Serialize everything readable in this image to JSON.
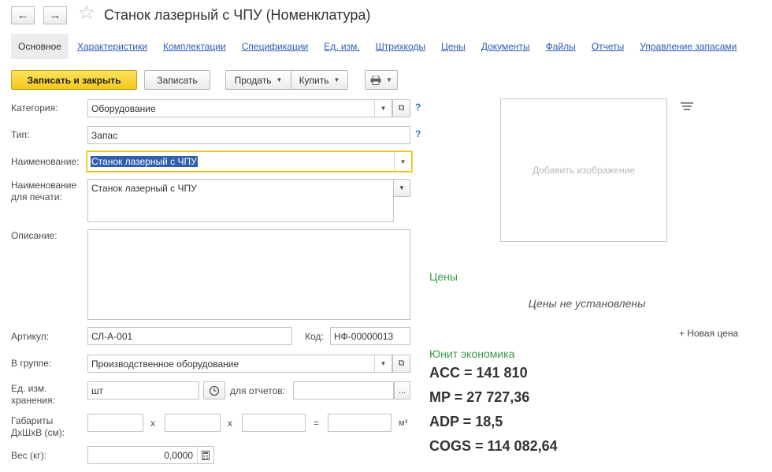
{
  "window": {
    "title": "Станок лазерный с ЧПУ (Номенклатура)",
    "back_icon": "←",
    "forward_icon": "→",
    "favorite_icon": "☆"
  },
  "tabs": [
    {
      "label": "Основное"
    },
    {
      "label": "Характеристики"
    },
    {
      "label": "Комплектации"
    },
    {
      "label": "Спецификации"
    },
    {
      "label": "Ед. изм."
    },
    {
      "label": "Штрихкоды"
    },
    {
      "label": "Цены"
    },
    {
      "label": "Документы"
    },
    {
      "label": "Файлы"
    },
    {
      "label": "Отчеты"
    },
    {
      "label": "Управление запасами"
    }
  ],
  "toolbar": {
    "save_close": "Записать и закрыть",
    "save": "Записать",
    "sell": "Продать",
    "buy": "Купить"
  },
  "form": {
    "category_label": "Категория:",
    "category_value": "Оборудование",
    "type_label": "Тип:",
    "type_value": "Запас",
    "name_label": "Наименование:",
    "name_value": "Станок лазерный с ЧПУ",
    "print_name_label": "Наименование для печати:",
    "print_name_value": "Станок лазерный с ЧПУ",
    "description_label": "Описание:",
    "article_label": "Артикул:",
    "article_value": "СЛ-А-001",
    "code_label": "Код:",
    "code_value": "НФ-00000013",
    "group_label": "В группе:",
    "group_value": "Производственное оборудование",
    "unit_label": "Ед. изм. хранения:",
    "unit_value": "шт",
    "report_unit_label": "для отчетов:",
    "dims_label": "Габариты ДхШхВ (см):",
    "dims_x1": "х",
    "dims_x2": "х",
    "dims_eq": "=",
    "dims_unit": "м³",
    "weight_label": "Вес (кг):",
    "weight_value": "0,0000",
    "help": "?"
  },
  "right": {
    "image_placeholder": "Добавить изображение",
    "prices_header": "Цены",
    "prices_empty": "Цены не установлены",
    "new_price": "+ Новая цена",
    "unit_econ_header": "Юнит экономика",
    "acc": "ACC = 141 810",
    "mp": "MP = 27 727,36",
    "adp": "ADP = 18,5",
    "cogs": "COGS = 114 082,64"
  }
}
